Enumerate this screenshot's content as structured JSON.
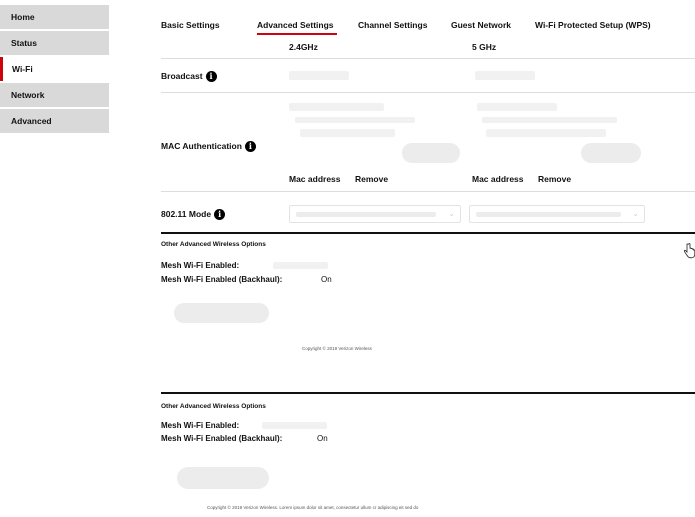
{
  "sidebar": {
    "items": [
      {
        "label": "Home"
      },
      {
        "label": "Status"
      },
      {
        "label": "Wi-Fi"
      },
      {
        "label": "Network"
      },
      {
        "label": "Advanced"
      }
    ]
  },
  "tabs": [
    {
      "label": "Basic Settings"
    },
    {
      "label": "Advanced Settings"
    },
    {
      "label": "Channel Settings"
    },
    {
      "label": "Guest Network"
    },
    {
      "label": "Wi-Fi Protected Setup (WPS)"
    }
  ],
  "bands": {
    "band_24": "2.4GHz",
    "band_5": "5 GHz"
  },
  "rows": {
    "broadcast": "Broadcast",
    "mac_auth": "MAC Authentication",
    "mode": "802.11 Mode"
  },
  "mac_table": {
    "col_address": "Mac address",
    "col_remove": "Remove"
  },
  "other_section_1": {
    "title": "Other Advanced Wireless Options",
    "mesh_label": "Mesh Wi-Fi Enabled:",
    "mesh_backhaul_label": "Mesh Wi-Fi Enabled (Backhaul):",
    "mesh_backhaul_value": "On",
    "footer": "Copyright © 2019 Verizon Wireless"
  },
  "other_section_2": {
    "title": "Other Advanced Wireless Options",
    "mesh_label": "Mesh Wi-Fi Enabled:",
    "mesh_backhaul_label": "Mesh Wi-Fi Enabled (Backhaul):",
    "mesh_backhaul_value": "On",
    "footer": "Copyright © 2019 Verizon Wireless. Lorem ipsum dolor sit amet, consectetur ullum cr adipiscing eit sed do"
  },
  "icons": {
    "info": "info-icon",
    "cursor": "hand-pointer-icon"
  },
  "colors": {
    "accent": "#cd040b",
    "sidebar_bg": "#d9d9d9"
  }
}
